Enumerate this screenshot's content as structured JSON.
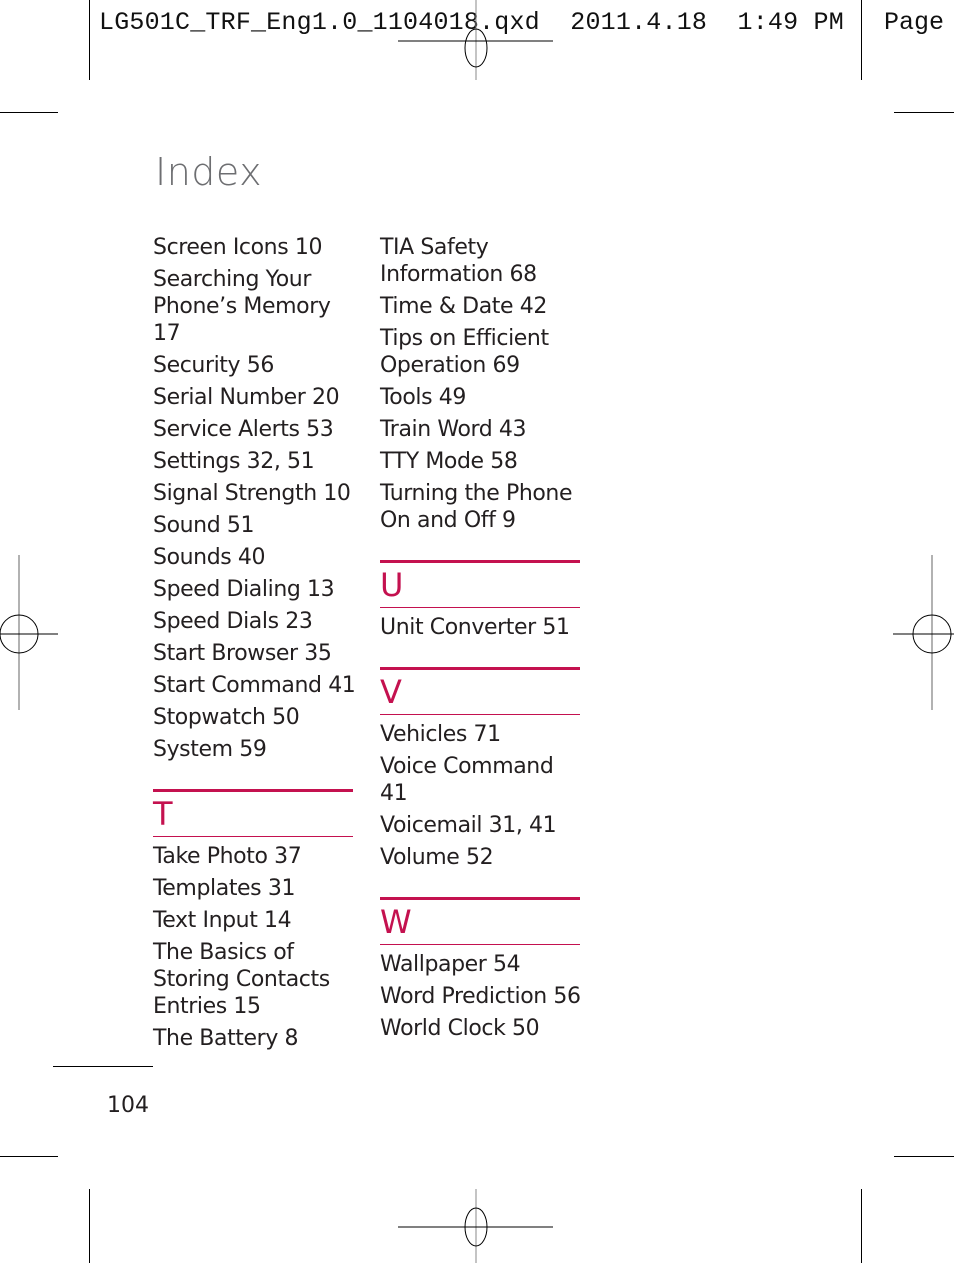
{
  "print_slug": {
    "filename": "LG501C_TRF_Eng1.0_1104018.qxd",
    "date": "2011.4.18",
    "time": "1:49 PM",
    "page_label": "Page"
  },
  "page": {
    "title": "Index",
    "page_number": "104",
    "accent_color": "#c4114f"
  },
  "columns": [
    {
      "entries_before": [
        "Screen Icons 10",
        "Searching Your Phone’s Memory 17",
        "Security 56",
        "Serial Number 20",
        "Service Alerts 53",
        "Settings 32, 51",
        "Signal Strength 10",
        "Sound 51",
        "Sounds 40",
        "Speed Dialing 13",
        "Speed Dials 23",
        "Start Browser 35",
        "Start Command 41",
        "Stopwatch 50",
        "System 59"
      ],
      "sections": [
        {
          "letter": "T",
          "entries": [
            "Take Photo 37",
            "Templates 31",
            "Text Input 14",
            "The Basics of Storing Contacts Entries 15",
            "The Battery 8"
          ]
        }
      ]
    },
    {
      "entries_before": [
        "TIA Safety Information 68",
        "Time & Date 42",
        "Tips on Efficient Operation 69",
        "Tools 49",
        "Train Word 43",
        "TTY Mode 58",
        "Turning the Phone On and Off 9"
      ],
      "sections": [
        {
          "letter": "U",
          "entries": [
            "Unit Converter 51"
          ]
        },
        {
          "letter": "V",
          "entries": [
            "Vehicles 71",
            "Voice Command 41",
            "Voicemail 31, 41",
            "Volume 52"
          ]
        },
        {
          "letter": "W",
          "entries": [
            "Wallpaper 54",
            "Word Prediction 56",
            "World Clock 50"
          ]
        }
      ]
    }
  ]
}
